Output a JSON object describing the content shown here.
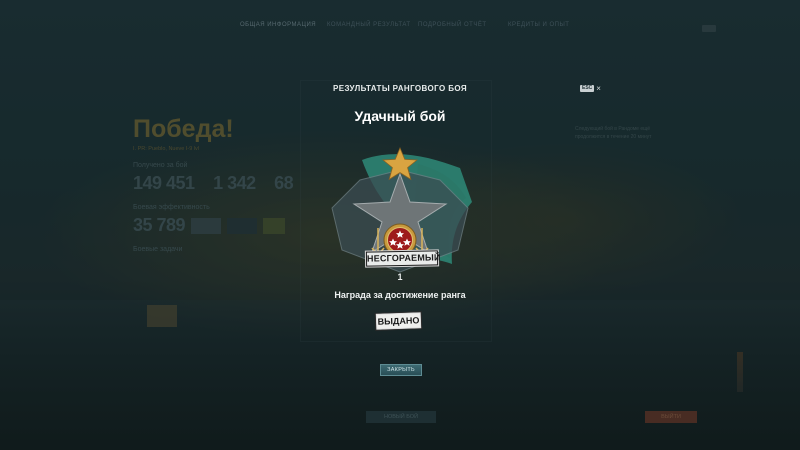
{
  "background": {
    "top_tabs": [
      "Общая информация",
      "Командный результат",
      "Подробный отчёт",
      "Кредиты и опыт"
    ],
    "victory_title": "Победа!",
    "victory_subtitle": "I. PR: Pueblo, Nueve I-9 lvl",
    "earned_section_label": "Получено за бой",
    "earned_values": [
      "149 451",
      "1 342",
      "68"
    ],
    "efficiency_label": "Боевая эффективность",
    "efficiency_value": "35 789",
    "tasks_label": "Боевые задачи",
    "right_note": "Следующий бой в Рандоме ещё продолжится в течение 20 минут",
    "bottom_left_button": "НОВЫЙ БОЙ",
    "bottom_right_button": "ВЫЙТИ"
  },
  "modal": {
    "title": "РЕЗУЛЬТАТЫ РАНГОВОГО БОЯ",
    "esc_key": "ESC",
    "close_icon": "×",
    "result_heading": "Удачный бой",
    "rank_label": "НЕСГОРАЕМЫЙ",
    "rank_number": "1",
    "reward_text": "Награда за достижение ранга",
    "reward_status": "ВЫДАНО",
    "close_button": "ЗАКРЫТЬ"
  },
  "colors": {
    "accent_gold": "#d9a441",
    "emblem_red": "#9e1b1b",
    "flag_teal": "#2f8f7e",
    "button_teal": "#3d6a72"
  }
}
